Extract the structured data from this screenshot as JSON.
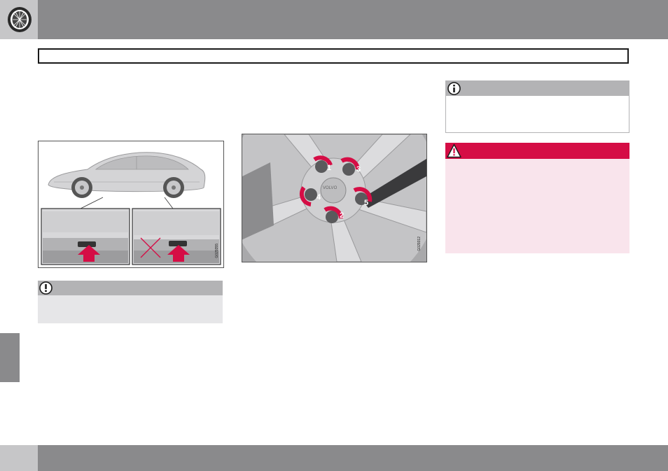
{
  "header": {
    "icon": "tire-icon"
  },
  "figures": {
    "car": {
      "code": "G029355",
      "icons": [
        "car-side-icon",
        "jack-point-icon",
        "arrow-up-icon",
        "cross-mark-icon"
      ]
    },
    "wheel": {
      "code": "G029312",
      "hub_logo": "VOLVO",
      "bolt_labels": [
        "1",
        "2",
        "3",
        "4",
        "5"
      ],
      "accent": "#d50d45"
    }
  },
  "boxes": {
    "important": {
      "icon": "exclamation-icon",
      "header_color": "#b3b3b5",
      "body_color": "#e6e6e8"
    },
    "note": {
      "icon": "info-icon",
      "header_color": "#b3b3b5"
    },
    "warning": {
      "icon": "warning-triangle-icon",
      "header_color": "#d50d45",
      "body_color": "#f9e4ec"
    }
  },
  "colors": {
    "bar_gray": "#8a8a8c",
    "tab_light": "#c6c6c8",
    "accent_red": "#d50d45"
  }
}
